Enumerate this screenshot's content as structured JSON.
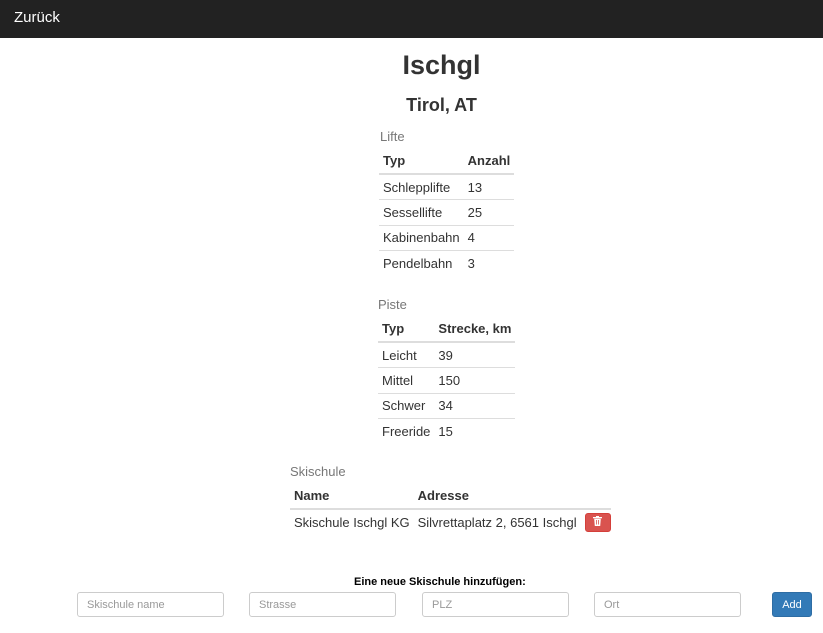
{
  "navbar": {
    "back_label": "Zurück"
  },
  "resort": {
    "name": "Ischgl",
    "region": "Tirol, AT"
  },
  "lifte": {
    "caption": "Lifte",
    "headers": [
      "Typ",
      "Anzahl"
    ],
    "rows": [
      [
        "Schlepplifte",
        "13"
      ],
      [
        "Sessellifte",
        "25"
      ],
      [
        "Kabinenbahn",
        "4"
      ],
      [
        "Pendelbahn",
        "3"
      ]
    ]
  },
  "piste": {
    "caption": "Piste",
    "headers": [
      "Typ",
      "Strecke, km"
    ],
    "rows": [
      [
        "Leicht",
        "39"
      ],
      [
        "Mittel",
        "150"
      ],
      [
        "Schwer",
        "34"
      ],
      [
        "Freeride",
        "15"
      ]
    ]
  },
  "skischule": {
    "caption": "Skischule",
    "headers": [
      "Name",
      "Adresse"
    ],
    "rows": [
      [
        "Skischule Ischgl KG",
        "Silvrettaplatz 2, 6561 Ischgl"
      ]
    ],
    "delete_icon": "trash-icon"
  },
  "form": {
    "title": "Eine neue Skischule hinzufügen:",
    "name_placeholder": "Skischule name",
    "strasse_placeholder": "Strasse",
    "plz_placeholder": "PLZ",
    "ort_placeholder": "Ort",
    "add_label": "Add"
  },
  "colors": {
    "navbar_bg": "#222222",
    "danger": "#d9534f",
    "primary": "#337ab7"
  }
}
